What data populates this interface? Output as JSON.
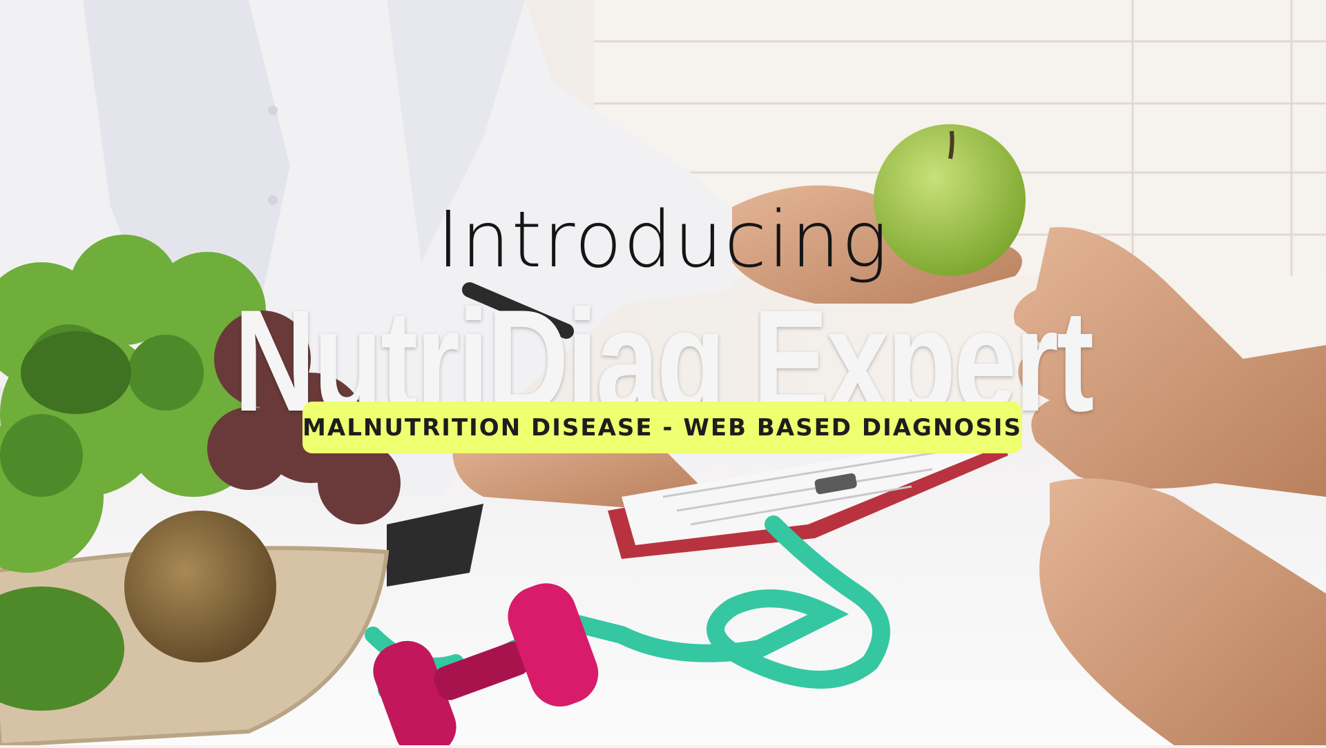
{
  "hero": {
    "intro_text": "Introducing",
    "brand_name": "NutriDiag Expert",
    "tagline": "MALNUTRITION DISEASE - WEB BASED DIAGNOSIS"
  },
  "colors": {
    "tagline_background": "#eeff6f",
    "brand_text": "#f5f5f5",
    "intro_text": "#151515"
  }
}
